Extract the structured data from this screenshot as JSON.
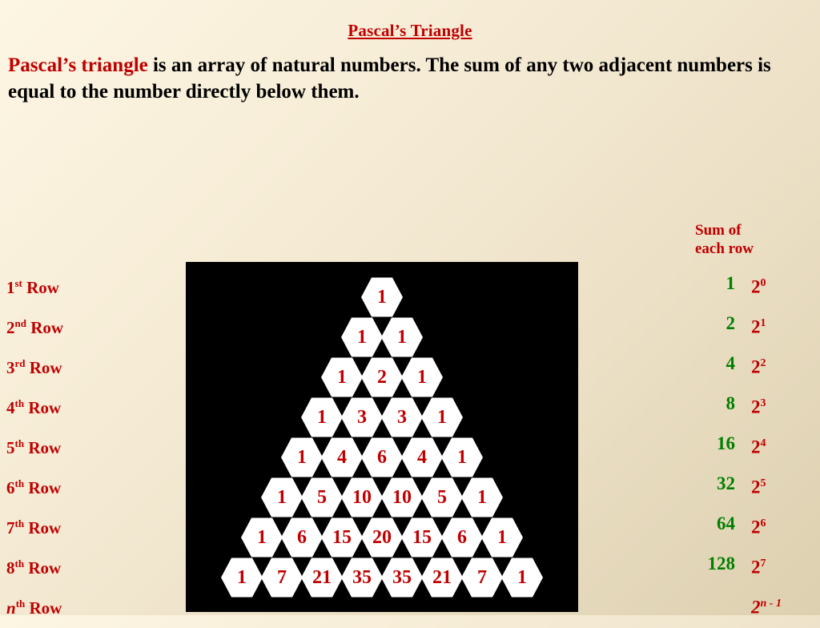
{
  "title": "Pascal’s Triangle",
  "intro": {
    "highlight": "Pascal’s triangle",
    "rest": " is an array of natural numbers. The sum of any two adjacent numbers is equal to the number directly below them."
  },
  "row_labels": [
    {
      "ord": "1",
      "sup": "st",
      "word": " Row",
      "italic": false
    },
    {
      "ord": "2",
      "sup": "nd",
      "word": " Row",
      "italic": false
    },
    {
      "ord": "3",
      "sup": "rd",
      "word": " Row",
      "italic": false
    },
    {
      "ord": "4",
      "sup": "th",
      "word": " Row",
      "italic": false
    },
    {
      "ord": "5",
      "sup": "th",
      "word": " Row",
      "italic": false
    },
    {
      "ord": "6",
      "sup": "th",
      "word": " Row",
      "italic": false
    },
    {
      "ord": "7",
      "sup": "th",
      "word": " Row",
      "italic": false
    },
    {
      "ord": "8",
      "sup": "th",
      "word": " Row",
      "italic": false
    },
    {
      "ord": "n",
      "sup": "th",
      "word": " Row",
      "italic": true
    }
  ],
  "sum_header_line1": "Sum of",
  "sum_header_line2": "each row",
  "sums": [
    "1",
    "2",
    "4",
    "8",
    "16",
    "32",
    "64",
    "128",
    ""
  ],
  "powers": [
    {
      "base": "2",
      "exp": "0",
      "italic": false
    },
    {
      "base": "2",
      "exp": "1",
      "italic": false
    },
    {
      "base": "2",
      "exp": "2",
      "italic": false
    },
    {
      "base": "2",
      "exp": "3",
      "italic": false
    },
    {
      "base": "2",
      "exp": "4",
      "italic": false
    },
    {
      "base": "2",
      "exp": "5",
      "italic": false
    },
    {
      "base": "2",
      "exp": "6",
      "italic": false
    },
    {
      "base": "2",
      "exp": "7",
      "italic": false
    },
    {
      "base": "2",
      "exp": "n - 1",
      "italic": true
    }
  ],
  "chart_data": {
    "type": "table",
    "title": "Pascal’s Triangle",
    "rows": [
      [
        1
      ],
      [
        1,
        1
      ],
      [
        1,
        2,
        1
      ],
      [
        1,
        3,
        3,
        1
      ],
      [
        1,
        4,
        6,
        4,
        1
      ],
      [
        1,
        5,
        10,
        10,
        5,
        1
      ],
      [
        1,
        6,
        15,
        20,
        15,
        6,
        1
      ],
      [
        1,
        7,
        21,
        35,
        35,
        21,
        7,
        1
      ]
    ],
    "row_sums": [
      1,
      2,
      4,
      8,
      16,
      32,
      64,
      128
    ],
    "row_sum_formula": "2^(n-1)"
  },
  "colors": {
    "heading_red": "#c00000",
    "sum_green": "#008000",
    "panel_bg": "#000000",
    "hex_fill": "#ffffff"
  }
}
